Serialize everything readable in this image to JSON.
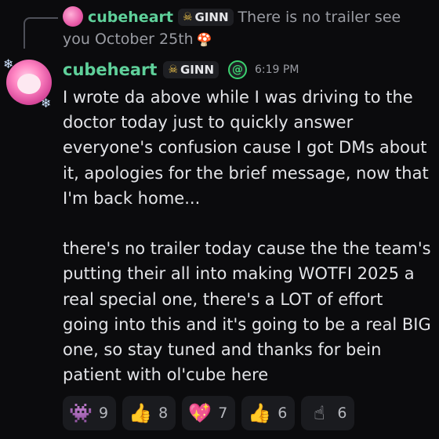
{
  "reply": {
    "username": "cubeheart",
    "tag": "GINN",
    "text": "There is no trailer see you October 25th"
  },
  "message": {
    "username": "cubeheart",
    "tag": "GINN",
    "timestamp": "6:19 PM",
    "body": "I wrote da above while I was driving to the doctor today just to quickly answer everyone's confusion cause I got DMs about it, apologies for the brief message, now that I'm back home...\n\nthere's no trailer today cause the the team's putting their all into making WOTFI 2025 a real special one, there's a LOT of effort going into this and it's going to be a real BIG one, so stay tuned and thanks for bein patient with ol'cube here"
  },
  "reactions": [
    {
      "icon": "pixel-emoji-icon",
      "count": "9"
    },
    {
      "icon": "thumbs-up-icon",
      "count": "8"
    },
    {
      "icon": "sparkling-heart-icon",
      "count": "7"
    },
    {
      "icon": "thumbs-up-character-icon",
      "count": "6"
    },
    {
      "icon": "this-sign-icon",
      "count": "6"
    }
  ],
  "colors": {
    "username": "#5fd09a",
    "background": "#0b0b0d",
    "muted": "#9a9ca3"
  }
}
